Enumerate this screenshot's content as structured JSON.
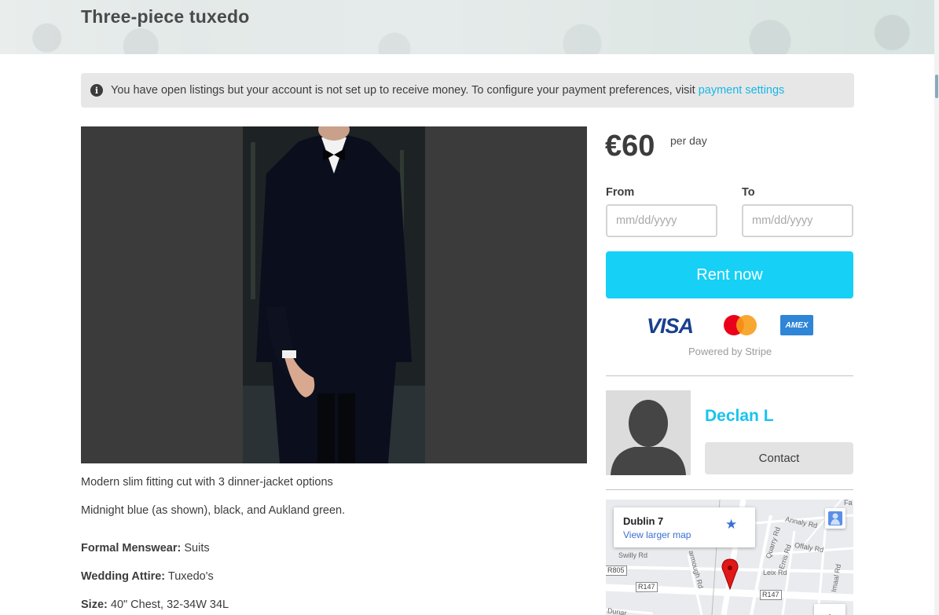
{
  "listing": {
    "title": "Three-piece tuxedo",
    "description_lines": [
      "Modern slim fitting cut with 3 dinner-jacket options",
      "Midnight blue (as shown), black, and Aukland green."
    ],
    "attributes": [
      {
        "label": "Formal Menswear:",
        "value": "Suits"
      },
      {
        "label": "Wedding Attire:",
        "value": "Tuxedo's"
      },
      {
        "label": "Size:",
        "value": "40\" Chest, 32-34W 34L"
      }
    ]
  },
  "alert": {
    "icon": "info-icon",
    "text": "You have open listings but your account is not set up to receive money. To configure your payment preferences, visit",
    "link_text": "payment settings"
  },
  "booking": {
    "price": "€60",
    "unit": "per day",
    "from_label": "From",
    "to_label": "To",
    "from_placeholder": "mm/dd/yyyy",
    "to_placeholder": "mm/dd/yyyy",
    "rent_button": "Rent now",
    "payment_methods": [
      "visa-logo",
      "mastercard-logo",
      "amex-logo"
    ],
    "visa_text": "VISA",
    "amex_text": "AMEX",
    "powered_by": "Powered by Stripe"
  },
  "owner": {
    "name": "Declan L",
    "contact_button": "Contact"
  },
  "map": {
    "place": "Dublin 7",
    "link": "View larger map",
    "labels": {
      "annaly": "Annaly Rd",
      "quarry": "Quarry Rd",
      "erris": "Erris Rd",
      "offaly": "Offaly Rd",
      "swilly": "Swilly Rd",
      "leix": "Leix Rd",
      "imaal": "Imaal Rd",
      "armorough": "armough Rd",
      "dunard": "Dunar",
      "fa": "Fa"
    },
    "road_badges": [
      "R805",
      "R147",
      "R147"
    ],
    "zoom_in": "+"
  },
  "colors": {
    "accent": "#16d0f6",
    "link": "#17b7e6",
    "alert_bg": "#e7e7e7"
  }
}
